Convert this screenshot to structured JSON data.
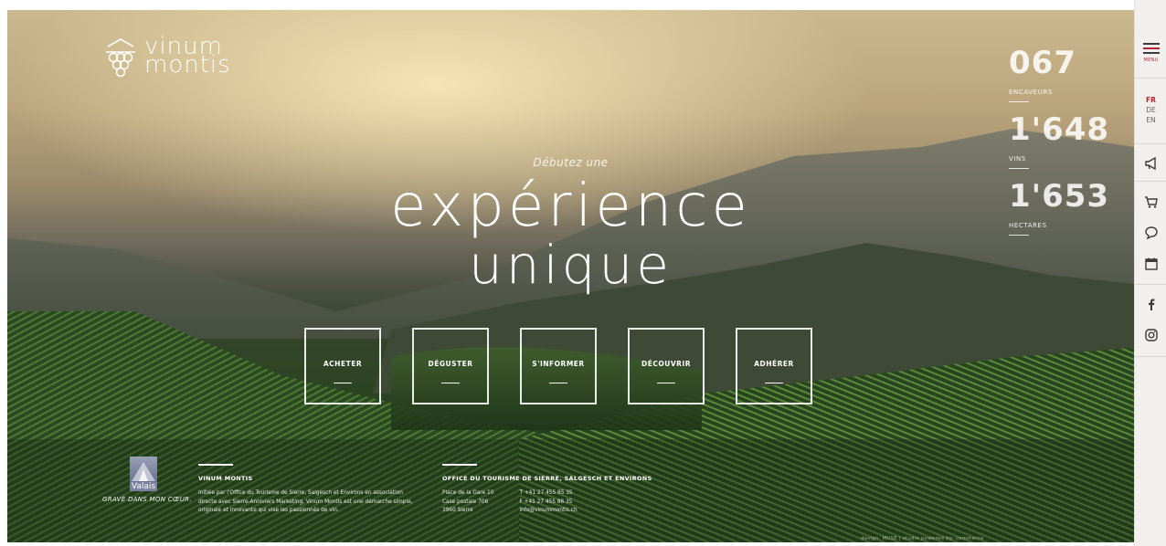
{
  "logo": {
    "line1": "vinum",
    "line2": "montis"
  },
  "stats": [
    {
      "value": "067",
      "label": "ENCAVEURS"
    },
    {
      "value": "1'648",
      "label": "VINS"
    },
    {
      "value": "1'653",
      "label": "HECTARES"
    }
  ],
  "hero": {
    "tagline_small": "Débutez une",
    "tagline_big_1": "expérience",
    "tagline_big_2": "unique"
  },
  "actions": [
    "ACHETER",
    "DÉGUSTER",
    "S'INFORMER",
    "DÉCOUVRIR",
    "ADHÉRER"
  ],
  "footer": {
    "valais_name": "Valais",
    "valais_slogan": "GRAVÉ DANS MON CŒUR.",
    "vinum_title": "VINUM MONTIS",
    "vinum_text": "Initiée par l'Office du Tourisme de Sierre, Salgesch et Environs en association directe avec Sierre-Anniviers Marketing, Vinum Montis est une démarche simple, originale et innovante qui vise les passionnés de vin.",
    "office_title": "OFFICE DU TOURISME DE SIERRE, SALGESCH ET ENVIRONS",
    "address_1": "Place de la Gare 10",
    "address_2": "Case postale 706",
    "address_3": "3960 Sierre",
    "phone": "T +41 27 455 85 35",
    "fax": "F +41 27 455 86 35",
    "email": "info@vinummontis.ch",
    "credits": "design: MUSE | studio   powered by: commerce"
  },
  "sidebar": {
    "menu_label": "MENU",
    "languages": [
      {
        "code": "FR",
        "active": true
      },
      {
        "code": "DE",
        "active": false
      },
      {
        "code": "EN",
        "active": false
      }
    ],
    "icons": [
      "megaphone-icon",
      "cart-icon",
      "chat-icon",
      "calendar-icon",
      "facebook-icon",
      "instagram-icon"
    ]
  },
  "colors": {
    "accent": "#b3262f",
    "sidebar_bg": "#f2f0ef",
    "text_dark": "#3b3b3b"
  }
}
